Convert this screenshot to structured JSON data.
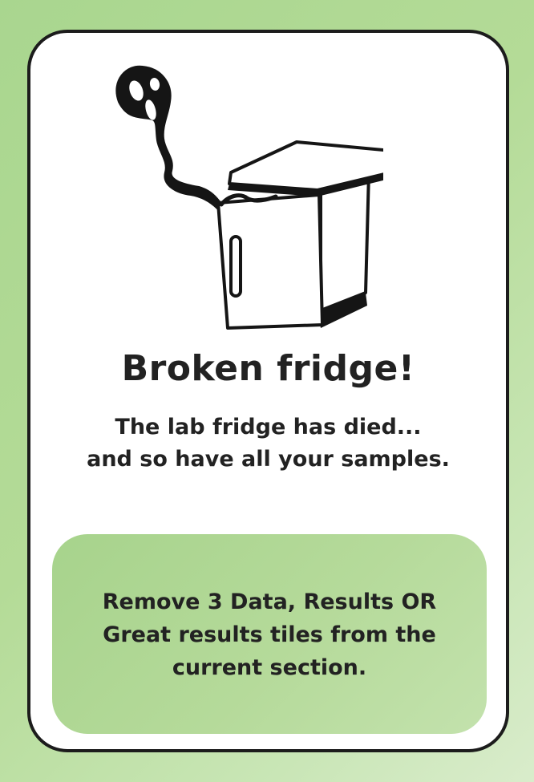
{
  "card": {
    "title": "Broken fridge!",
    "flavor_lines": [
      "The lab fridge has died...",
      "and so have all your samples."
    ],
    "effect_lines": [
      "Remove 3 Data, Results OR",
      "Great results tiles from the",
      "current section."
    ],
    "illustration": "broken-fridge-with-smoke-icon"
  },
  "colors": {
    "background": "#b4db97",
    "effect_box": "#b5da9a",
    "text": "#222222",
    "border": "#1c1c1c"
  }
}
